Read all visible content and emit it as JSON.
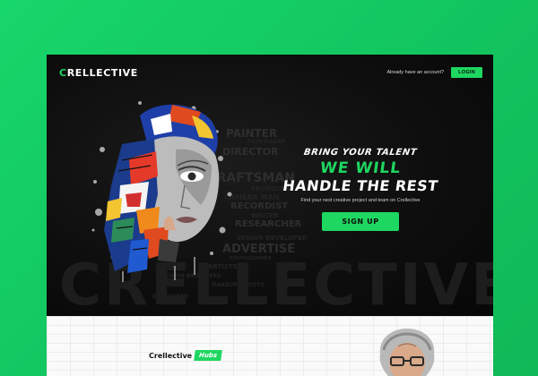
{
  "brand": {
    "name_prefix": "C",
    "name_rest": "RELLECTIVE"
  },
  "header": {
    "account_prompt": "Already have an account?",
    "login_label": "LOGIN"
  },
  "hero": {
    "tagline_1": "BRING YOUR TALENT",
    "tagline_2": "WE WILL",
    "tagline_3": "HANDLE THE REST",
    "subtext": "Find your next creative project and team on Crellective",
    "signup_label": "SIGN UP",
    "watermark": "CRELLECTIVE",
    "roles": [
      "PAINTER",
      "DIRECTOR",
      "FILM MAKER",
      "DRAFTSMAN",
      "PRODUCER",
      "RECORDIST",
      "WRITER",
      "RESEARCHER",
      "SENIOR DEVELOPER",
      "ADVERTISE",
      "ARTISTS",
      "FASHION DESIGNERS",
      "MAKEUP ARTISTS",
      "PHOTOGRAPHER",
      "DEVELOPER",
      "CAMERA MAN"
    ]
  },
  "hubs": {
    "label": "Crellective",
    "badge": "Hubs"
  },
  "colors": {
    "accent": "#1ed760",
    "background": "#17d66a",
    "hero_bg": "#0b0b0b"
  }
}
